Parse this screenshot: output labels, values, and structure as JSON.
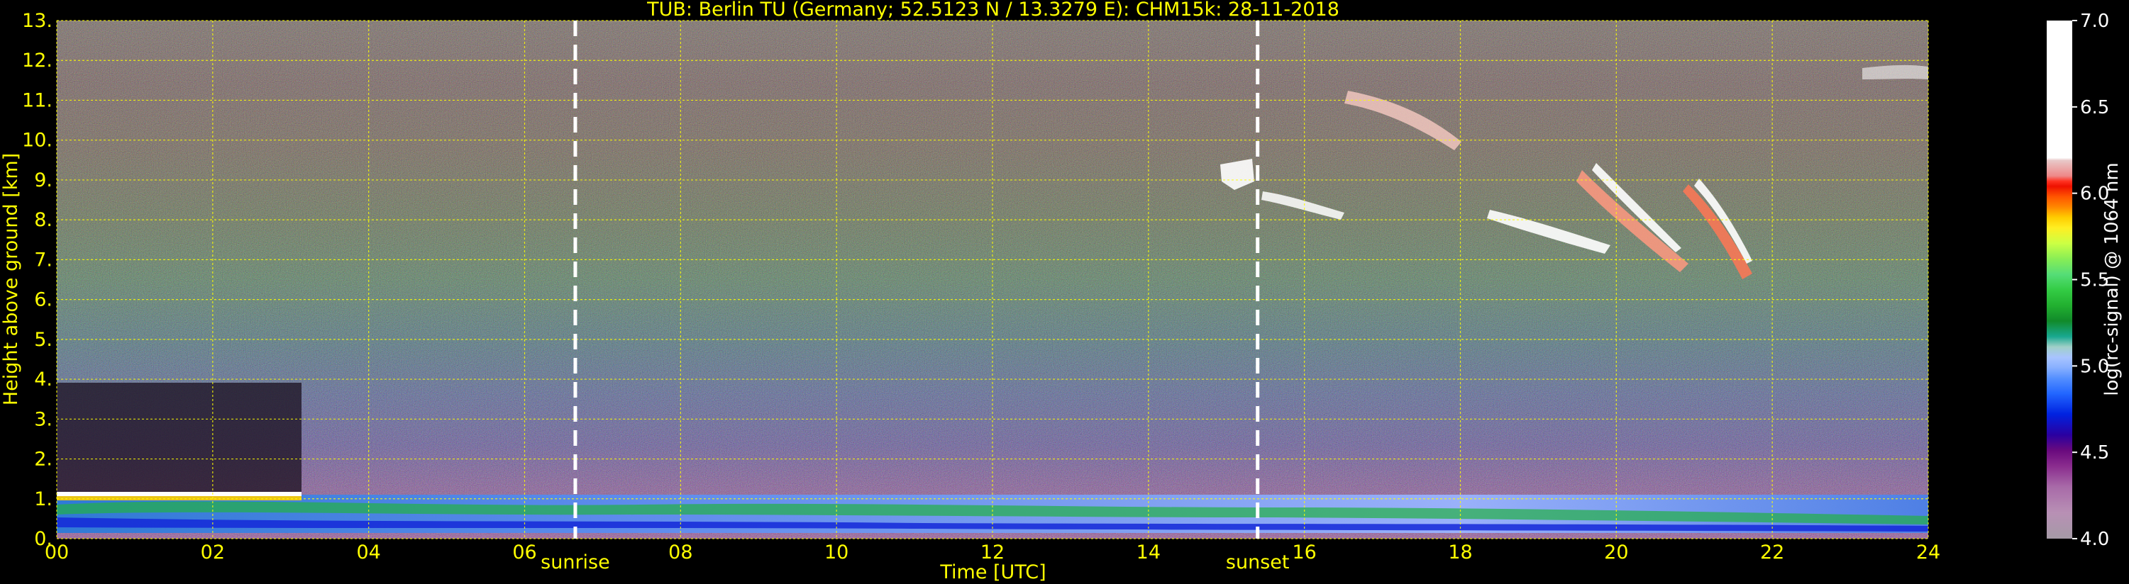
{
  "chart_data": {
    "type": "heatmap",
    "title": "TUB: Berlin TU (Germany; 52.5123 N / 13.3279 E):    CHM15k: 28-11-2018",
    "xlabel": "Time [UTC]",
    "ylabel": "Height above ground [km]",
    "x_ticks": [
      "00",
      "02",
      "04",
      "06",
      "08",
      "10",
      "12",
      "14",
      "16",
      "18",
      "20",
      "22",
      "24"
    ],
    "x_tick_values": [
      0,
      2,
      4,
      6,
      8,
      10,
      12,
      14,
      16,
      18,
      20,
      22,
      24
    ],
    "xlim": [
      0,
      24
    ],
    "y_ticks": [
      "0.",
      "1.",
      "2.",
      "3.",
      "4.",
      "5.",
      "6.",
      "7.",
      "8.",
      "9.",
      "10.",
      "11.",
      "12.",
      "13."
    ],
    "y_tick_values": [
      0,
      1,
      2,
      3,
      4,
      5,
      6,
      7,
      8,
      9,
      10,
      11,
      12,
      13
    ],
    "ylim": [
      0,
      13
    ],
    "grid": true,
    "markers": [
      {
        "label": "sunrise",
        "x": 6.65
      },
      {
        "label": "sunset",
        "x": 15.4
      }
    ],
    "colorbar": {
      "label": "log(rc-signal) @ 1064 nm",
      "range": [
        4.0,
        7.0
      ],
      "ticks": [
        "4.0",
        "4.5",
        "5.0",
        "5.5",
        "6.0",
        "6.5",
        "7.0"
      ],
      "tick_values": [
        4.0,
        4.5,
        5.0,
        5.5,
        6.0,
        6.5,
        7.0
      ],
      "colors": [
        "#a59aa6",
        "#b890b5",
        "#a86aa8",
        "#8a2c8e",
        "#6a0a7e",
        "#2a00a0",
        "#0022e0",
        "#2266ff",
        "#5590ff",
        "#88b0ff",
        "#a8c4ff",
        "#a0d0c8",
        "#18a890",
        "#118a2a",
        "#22b030",
        "#33cc44",
        "#55dd77",
        "#88ee55",
        "#ccff44",
        "#ffee22",
        "#ffcc00",
        "#ff8800",
        "#ff5500",
        "#ee1100",
        "#ff3322",
        "#ee8888",
        "#e8c8c8",
        "#ffffff"
      ]
    },
    "colors": {
      "text": "#ffff00",
      "grid": "#ffff00",
      "marker": "#ffffff"
    }
  }
}
